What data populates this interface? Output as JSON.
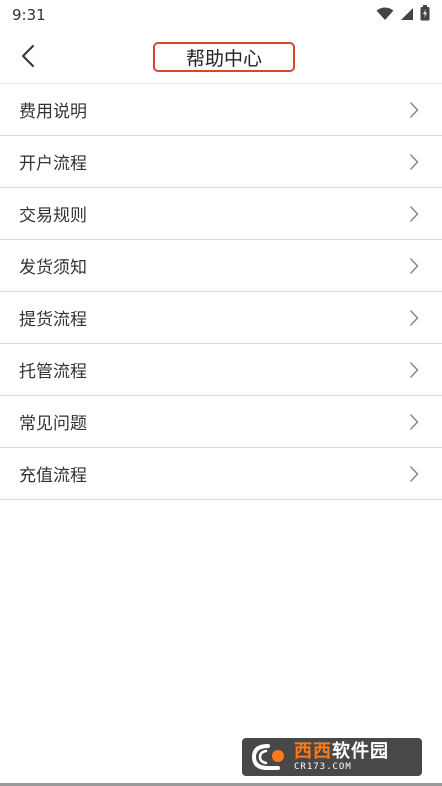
{
  "status_bar": {
    "time": "9:31",
    "icons": [
      "wifi-icon",
      "cell-signal-icon",
      "battery-charging-icon"
    ]
  },
  "header": {
    "back_icon": "chevron-left-icon",
    "title": "帮助中心",
    "highlight_color": "#d9472b"
  },
  "menu": {
    "items": [
      {
        "label": "费用说明",
        "icon": "chevron-right-icon"
      },
      {
        "label": "开户流程",
        "icon": "chevron-right-icon"
      },
      {
        "label": "交易规则",
        "icon": "chevron-right-icon"
      },
      {
        "label": "发货须知",
        "icon": "chevron-right-icon"
      },
      {
        "label": "提货流程",
        "icon": "chevron-right-icon"
      },
      {
        "label": "托管流程",
        "icon": "chevron-right-icon"
      },
      {
        "label": "常见问题",
        "icon": "chevron-right-icon"
      },
      {
        "label": "充值流程",
        "icon": "chevron-right-icon"
      }
    ]
  },
  "watermark": {
    "main_accent": "西西",
    "main_rest": "软件园",
    "sub": "CR173.COM",
    "accent_color": "#ff7a1a"
  }
}
